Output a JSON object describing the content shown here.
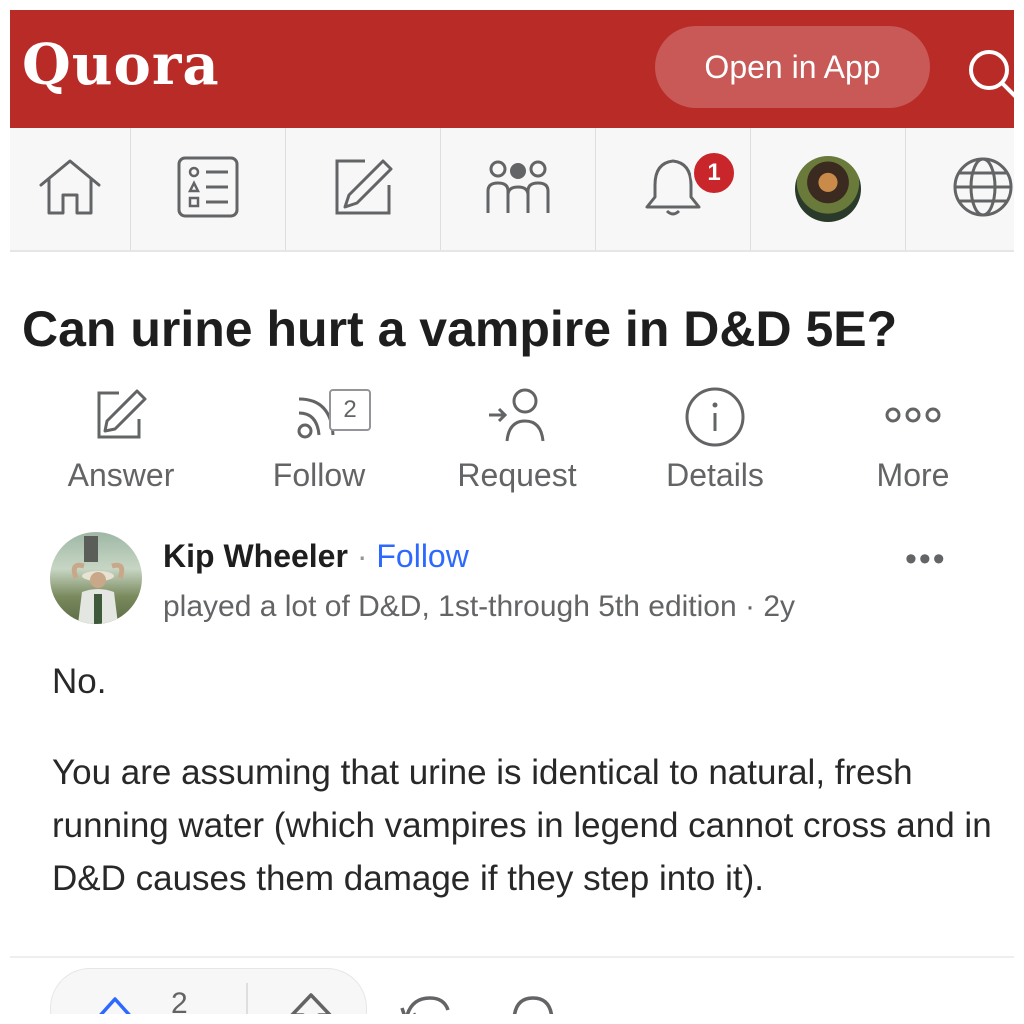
{
  "header": {
    "logo": "Quora",
    "open_app_label": "Open in App",
    "brand_color": "#b92b27"
  },
  "nav": {
    "items": [
      {
        "name": "home",
        "icon": "home-icon"
      },
      {
        "name": "following",
        "icon": "feed-list-icon"
      },
      {
        "name": "answer",
        "icon": "edit-icon"
      },
      {
        "name": "spaces",
        "icon": "people-icon"
      },
      {
        "name": "notifications",
        "icon": "bell-icon",
        "badge": "1"
      },
      {
        "name": "profile",
        "icon": "avatar"
      },
      {
        "name": "language",
        "icon": "globe-icon"
      }
    ]
  },
  "question": {
    "title": "Can urine hurt a vampire in D&D 5E?"
  },
  "actions": {
    "answer": "Answer",
    "follow": "Follow",
    "follow_count": "2",
    "request": "Request",
    "details": "Details",
    "more": "More"
  },
  "answer": {
    "author": "Kip Wheeler",
    "separator": "·",
    "follow": "Follow",
    "credential": "played a lot of D&D, 1st-through 5th edition · 2y",
    "more": "•••",
    "paragraphs": [
      "No.",
      "You are assuming that urine is identical to natural, fresh running water (which vampires in legend cannot cross and in D&D causes them damage if they step into it)."
    ]
  },
  "footer": {
    "upvote_count": "2"
  }
}
